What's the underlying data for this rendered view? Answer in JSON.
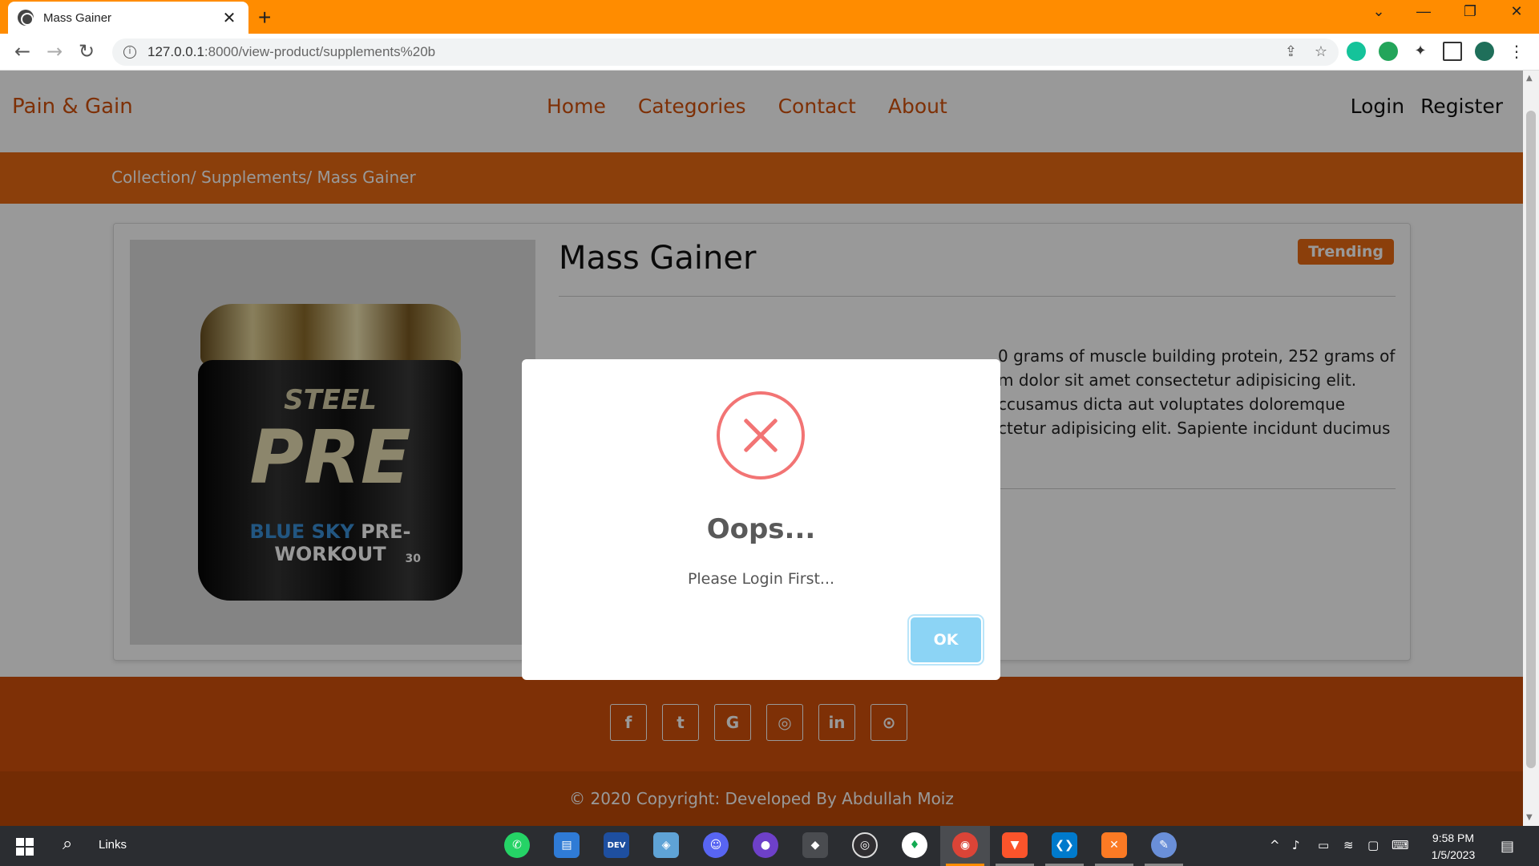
{
  "browser": {
    "tab_title": "Mass Gainer",
    "tab_close": "✕",
    "new_tab": "+",
    "url_host": "127.0.0.1",
    "url_rest": ":8000/view-product/supplements%20b"
  },
  "site": {
    "brand": "Pain & Gain",
    "nav": [
      "Home",
      "Categories",
      "Contact",
      "About"
    ],
    "auth": [
      "Login",
      "Register"
    ],
    "breadcrumb": "Collection/ Supplements/ Mass Gainer"
  },
  "product": {
    "title": "Mass Gainer",
    "badge": "Trending",
    "description_lines": [
      "0 grams of muscle building protein, 252 grams of",
      "m dolor sit amet consectetur adipisicing elit.",
      "ccusamus dicta aut voluptates doloremque",
      "ctetur adipisicing elit. Sapiente incidunt ducimus"
    ],
    "jar_text": {
      "line1": "STEEL",
      "line2": "PRE",
      "line3_a": "BLUE SKY",
      "line3_b": "PRE-WORKOUT",
      "count": "30"
    }
  },
  "footer": {
    "socials": [
      "facebook-icon",
      "twitter-icon",
      "google-icon",
      "instagram-icon",
      "linkedin-icon",
      "github-icon"
    ],
    "copyright": "© 2020 Copyright: Developed By Abdullah Moiz"
  },
  "modal": {
    "title": "Oops...",
    "text": "Please Login First...",
    "ok_label": "OK",
    "icon": "error-x-icon",
    "accent": "#f27474",
    "button_color": "#8cd4f5"
  },
  "taskbar": {
    "search_label": "Links",
    "time": "9:58 PM",
    "date": "1/5/2023",
    "apps": [
      "whatsapp-icon",
      "file-explorer-icon",
      "devcx-icon",
      "virtualbox-icon",
      "discord-icon",
      "github-desktop-icon",
      "git-icon",
      "obs-icon",
      "mongodb-icon",
      "chrome-icon",
      "brave-icon",
      "vscode-icon",
      "xampp-icon",
      "paint-icon"
    ]
  },
  "colors": {
    "brand_orange": "#d2500a",
    "tab_bar": "#ff8c00"
  }
}
